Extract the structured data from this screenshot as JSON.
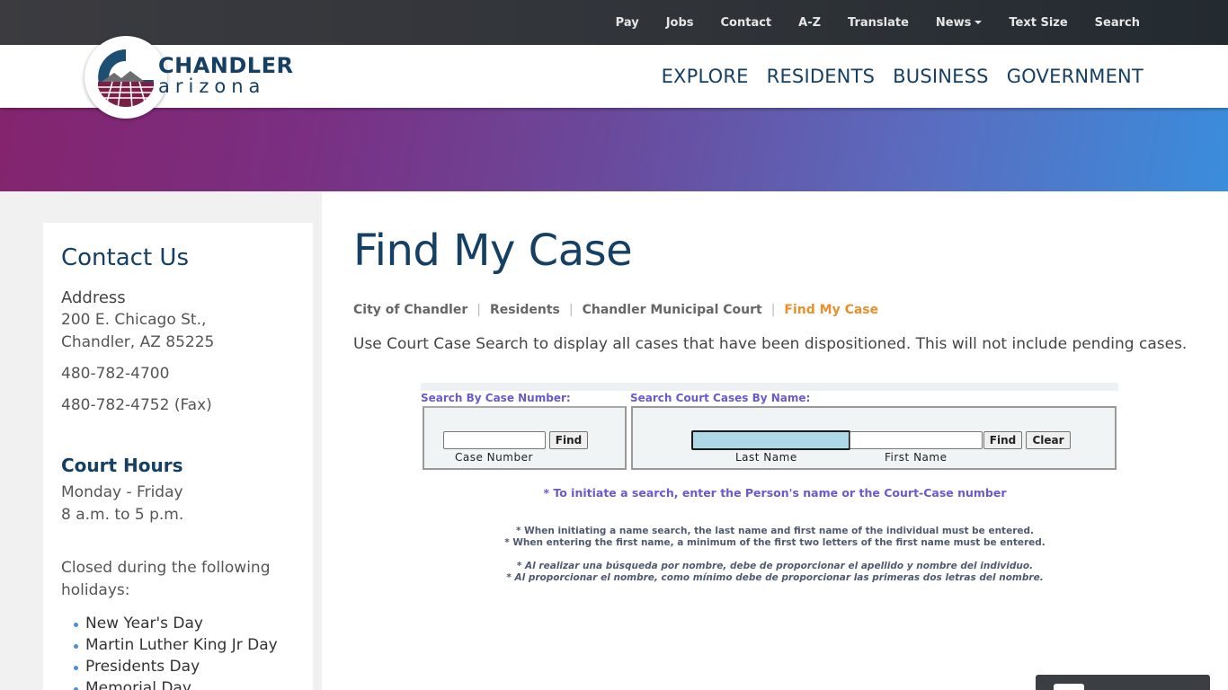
{
  "utility_nav": [
    "Pay",
    "Jobs",
    "Contact",
    "A-Z",
    "Translate",
    "News",
    "Text Size",
    "Search"
  ],
  "main_nav": [
    "EXPLORE",
    "RESIDENTS",
    "BUSINESS",
    "GOVERNMENT"
  ],
  "logo": {
    "word": "CHANDLER",
    "sub": "arizona"
  },
  "sidebar": {
    "title": "Contact Us",
    "address_label": "Address",
    "address_line1": "200 E. Chicago St.,",
    "address_line2": "Chandler, AZ 85225",
    "phone": "480-782-4700",
    "fax": "480-782-4752 (Fax)",
    "hours_title": "Court Hours",
    "hours_days": "Monday - Friday",
    "hours_time": "8 a.m. to 5 p.m.",
    "closed_text": "Closed during the following holidays:",
    "holidays": [
      "New Year's Day",
      "Martin Luther King Jr Day",
      "Presidents Day",
      "Memorial Day"
    ]
  },
  "page": {
    "title": "Find My Case",
    "breadcrumb": [
      "City of Chandler",
      "Residents",
      "Chandler Municipal Court",
      "Find My Case"
    ],
    "intro": "Use Court Case Search to display all cases that have been dispositioned. This will not include pending cases."
  },
  "search": {
    "case_legend": "Search By Case Number:",
    "name_legend": "Search Court Cases By Name:",
    "case_caption": "Case Number",
    "last_caption": "Last Name",
    "first_caption": "First Name",
    "find_label": "Find",
    "clear_label": "Clear",
    "case_value": "",
    "last_value": "",
    "first_value": "",
    "notice": "* To initiate a search, enter the Person's name or the Court-Case number",
    "rule_en_1": "* When initiating a name search, the last name and first name of the individual must be entered.",
    "rule_en_2": "* When entering the first name, a minimum of the first two letters of the first name must be entered.",
    "rule_es_1": "* Al realizar una búsqueda por nombre, debe de proporcionar el apellido y nombre del individuo.",
    "rule_es_2": "* Al proporcionar el nombre, como mínimo debe de proporcionar las primeras dos letras del nombre."
  },
  "colors": {
    "brand_navy": "#153f63",
    "breadcrumb_current": "#e8912a",
    "legend_purple": "#6a5acd"
  },
  "icons": {
    "news_dropdown": "caret-down-icon",
    "list_bullet": "bullet-icon"
  }
}
